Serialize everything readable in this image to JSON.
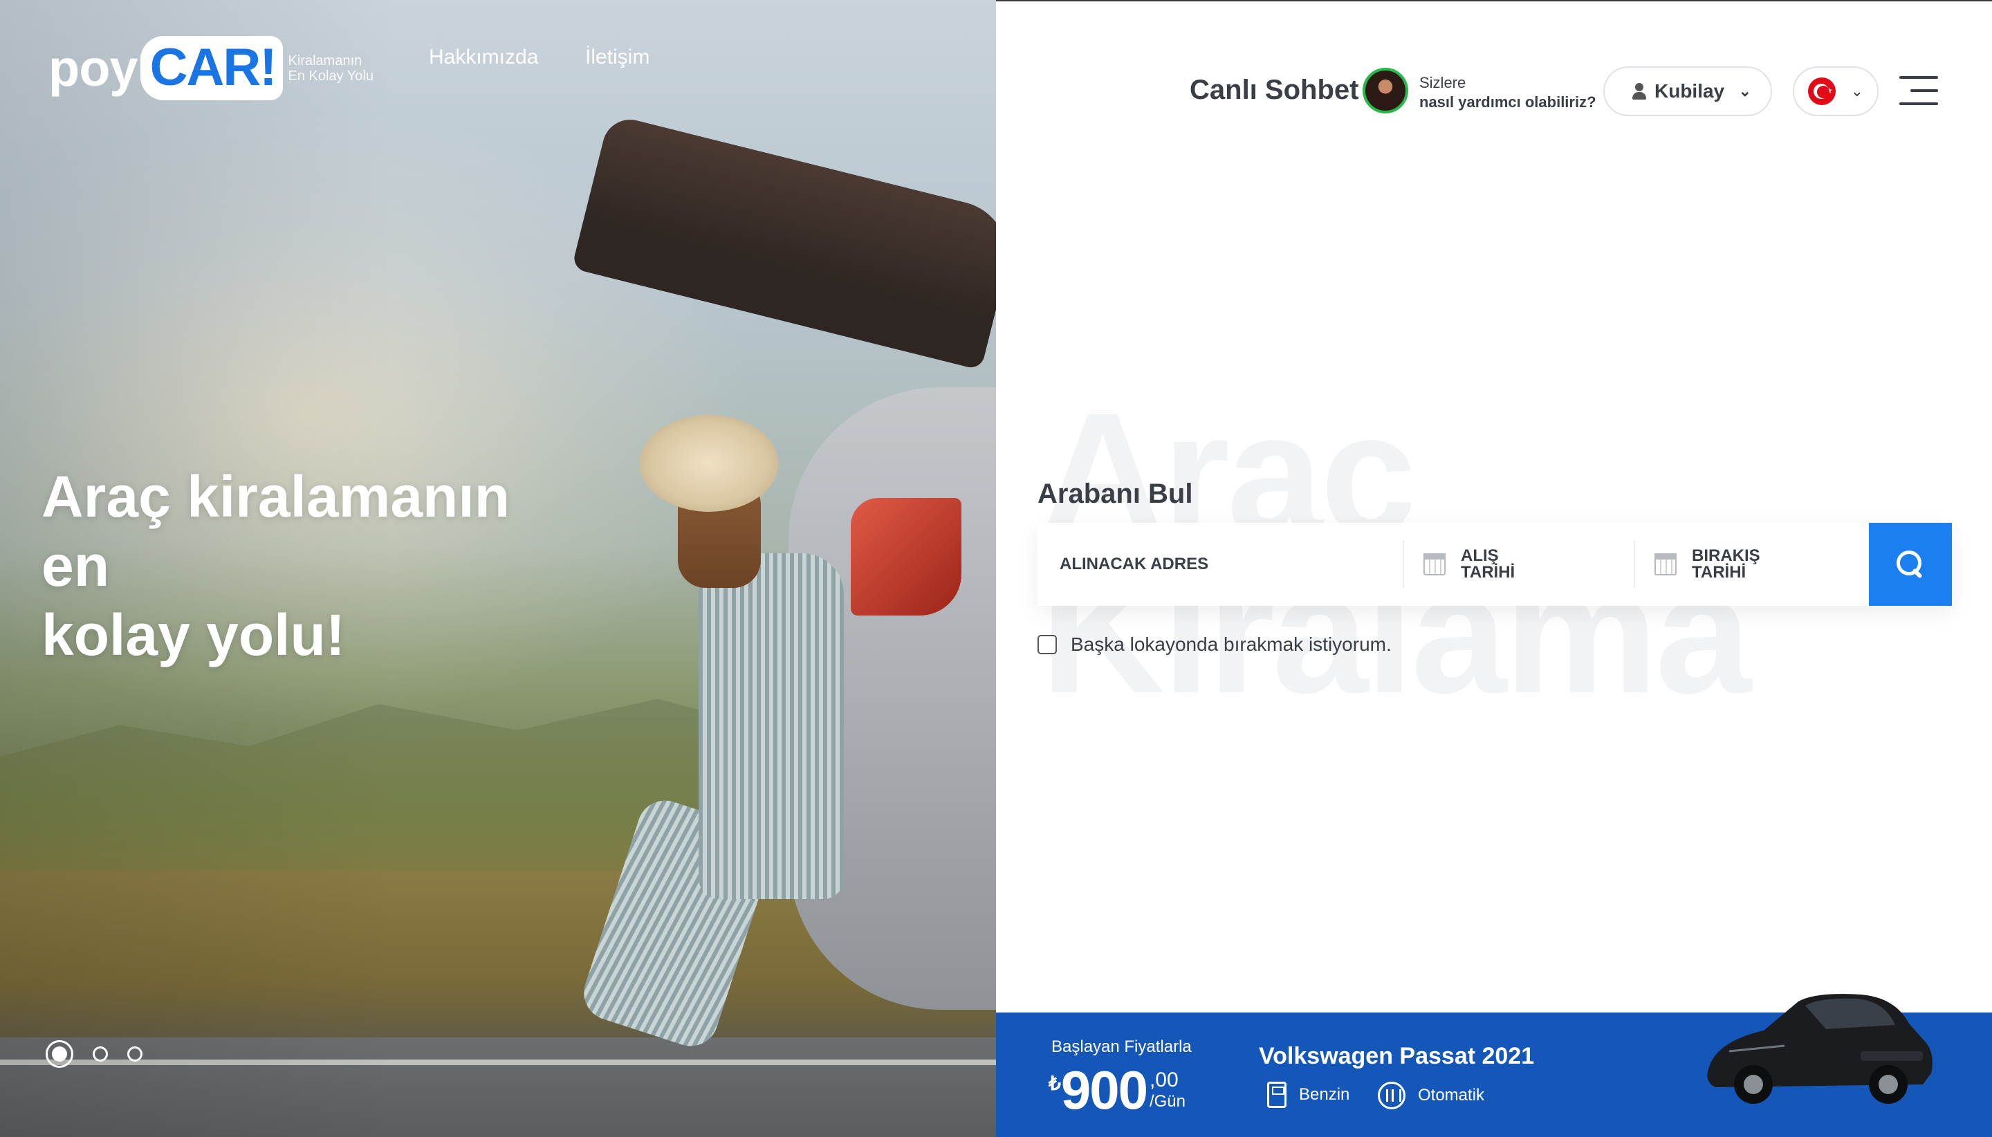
{
  "brand": {
    "prefix": "poy",
    "name": "CAR!",
    "tagline_line1": "Kiralamanın",
    "tagline_line2": "En Kolay Yolu",
    "accent": "#1b74e4"
  },
  "nav": {
    "about": "Hakkımızda",
    "contact": "İletişim"
  },
  "hero": {
    "line1": "Araç kiralamanın",
    "line2": "en",
    "line3": "kolay yolu!",
    "slides": 3,
    "active_slide": 1
  },
  "header": {
    "live_chat": "Canlı Sohbet",
    "agent_line1": "Sizlere",
    "agent_line2": "nasıl yardımcı olabiliriz?",
    "user_name": "Kubilay",
    "language_flag": "turkey-flag-icon"
  },
  "search": {
    "title": "Arabanı Bul",
    "watermark_line1": "Araç",
    "watermark_line2": "Kiralama",
    "pickup_address": "ALINACAK ADRES",
    "pickup_date_line1": "ALIŞ",
    "pickup_date_line2": "TARİHİ",
    "return_date_line1": "BIRAKIŞ",
    "return_date_line2": "TARİHİ",
    "other_location_label": "Başka lokayonda bırakmak istiyorum.",
    "button_color": "#1b7ff0"
  },
  "promo": {
    "from_label": "Başlayan Fiyatlarla",
    "currency": "₺",
    "amount": "900",
    "cents": ",00",
    "per": "/Gün",
    "model": "Volkswagen Passat 2021",
    "fuel": "Benzin",
    "transmission": "Otomatik",
    "bg_color": "#1557b8"
  }
}
